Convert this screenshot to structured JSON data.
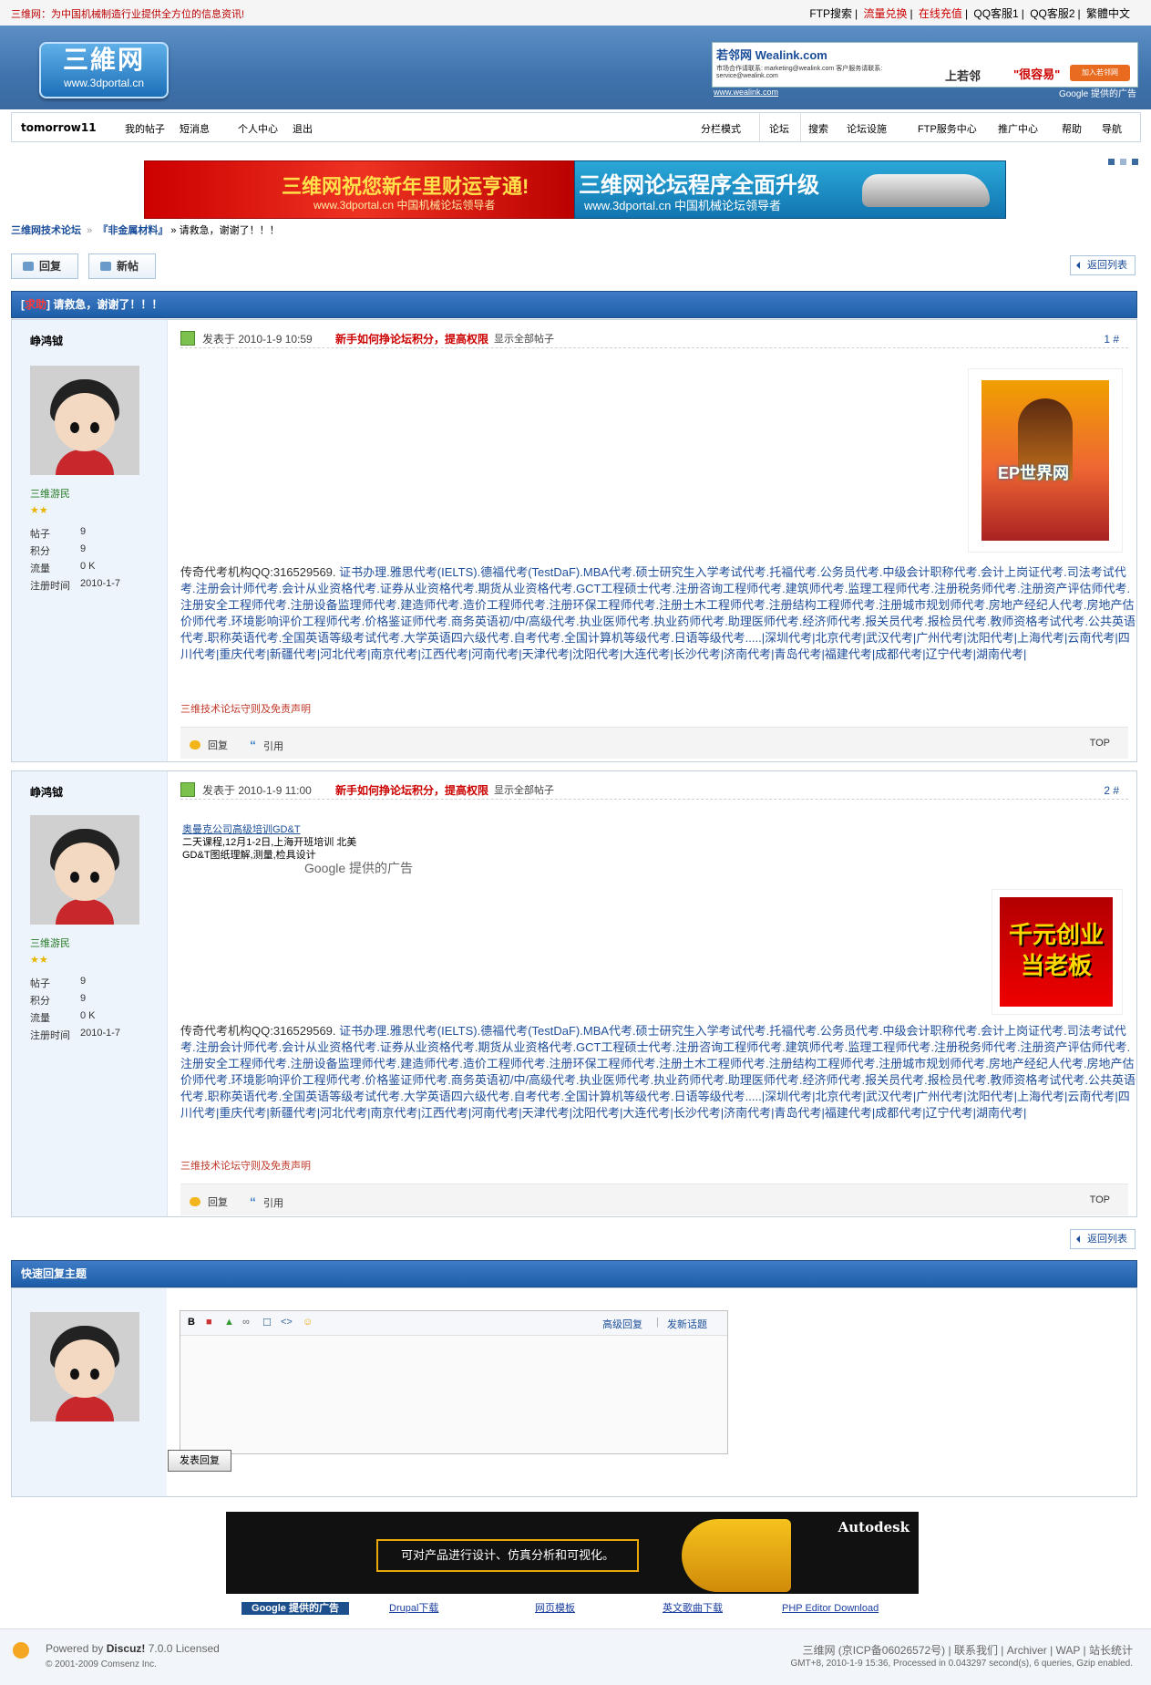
{
  "topbar": {
    "notice": "三维网：为中国机械制造行业提供全方位的信息资讯!",
    "links": [
      "FTP搜索",
      "流量兑换",
      "在线充值",
      "QQ客服1",
      "QQ客服2",
      "繁體中文"
    ]
  },
  "header": {
    "logo_text": "三維网",
    "logo_url": "www.3dportal.cn",
    "ad_brand": "若邻网 Wealink.com",
    "ad_contact": "市场合作请联系: marketing@wealink.com  客户服务请联系: service@wealink.com",
    "ad_slogan1": "上若邻",
    "ad_slogan2": "\"很容易\"",
    "ad_button": "加入若邻网",
    "ad_url": "www.wealink.com",
    "google_ad": "Google 提供的广告"
  },
  "nav": {
    "username": "tomorrow11",
    "left": [
      "我的帖子",
      "短消息",
      "个人中心",
      "退出"
    ],
    "right": [
      "分栏模式",
      "论坛",
      "搜索",
      "论坛设施",
      "FTP服务中心",
      "推广中心",
      "帮助",
      "导航"
    ],
    "current": "论坛"
  },
  "banners": {
    "b1_title": "三维网祝您新年里财运亨通!",
    "b1_sub": "www.3dportal.cn 中国机械论坛领导者",
    "b2_title": "三维网论坛程序全面升级",
    "b2_sub": "www.3dportal.cn 中国机械论坛领导者"
  },
  "breadcrumb": {
    "home": "三维网技术论坛",
    "board": "『非金属材料』",
    "current": "» 请救急，谢谢了！！！"
  },
  "buttons": {
    "reply": "回复",
    "newpost": "新帖",
    "back": "返回列表"
  },
  "thread": {
    "tag": "求助",
    "title": "请救急，谢谢了！！！"
  },
  "posts": [
    {
      "author": "峥鸿钺",
      "rank": "三维游民",
      "stars": "★★",
      "stats": [
        [
          "帖子",
          "9"
        ],
        [
          "积分",
          "9"
        ],
        [
          "流量",
          "0 K"
        ],
        [
          "注册时间",
          "2010-1-7"
        ]
      ],
      "date": "发表于 2010-1-9 10:59",
      "promo": "新手如何挣论坛积分，提高权限",
      "show_all": "显示全部帖子",
      "floor": "1 #",
      "image_text": "EP世界网",
      "lead": "传奇代考机构QQ:316529569.",
      "body": "证书办理.雅思代考(IELTS).德福代考(TestDaF).MBA代考.硕士研究生入学考试代考.托福代考.公务员代考.中级会计职称代考.会计上岗证代考.司法考试代考.注册会计师代考.会计从业资格代考.证券从业资格代考.期货从业资格代考.GCT工程硕士代考.注册咨询工程师代考.建筑师代考.监理工程师代考.注册税务师代考.注册资产评估师代考.注册安全工程师代考.注册设备监理师代考.建造师代考.造价工程师代考.注册环保工程师代考.注册土木工程师代考.注册结构工程师代考.注册城市规划师代考.房地产经纪人代考.房地产估价师代考.环境影响评价工程师代考.价格鉴证师代考.商务英语初/中/高级代考.执业医师代考.执业药师代考.助理医师代考.经济师代考.报关员代考.报检员代考.教师资格考试代考.公共英语代考.职称英语代考.全国英语等级考试代考.大学英语四六级代考.自考代考.全国计算机等级代考.日语等级代考.....|深圳代考|北京代考|武汉代考|广州代考|沈阳代考|上海代考|云南代考|四川代考|重庆代考|新疆代考|河北代考|南京代考|江西代考|河南代考|天津代考|沈阳代考|大连代考|长沙代考|济南代考|青岛代考|福建代考|成都代考|辽宁代考|湖南代考|",
      "rules": "三维技术论坛守则及免责声明",
      "reply": "回复",
      "quote": "引用",
      "top": "TOP"
    },
    {
      "author": "峥鸿钺",
      "rank": "三维游民",
      "stars": "★★",
      "stats": [
        [
          "帖子",
          "9"
        ],
        [
          "积分",
          "9"
        ],
        [
          "流量",
          "0 K"
        ],
        [
          "注册时间",
          "2010-1-7"
        ]
      ],
      "date": "发表于 2010-1-9 11:00",
      "promo": "新手如何挣论坛积分，提高权限",
      "show_all": "显示全部帖子",
      "floor": "2 #",
      "inline_ad_title": "奥曼克公司高级培训GD&T",
      "inline_ad_line1": "二天课程,12月1-2日,上海开班培训  北美",
      "inline_ad_line2": "GD&T图纸理解,测量,检具设计",
      "inline_ad_brand": "Google 提供的广告",
      "image_text": "千元创业当老板",
      "lead": "传奇代考机构QQ:316529569.",
      "body": "证书办理.雅思代考(IELTS).德福代考(TestDaF).MBA代考.硕士研究生入学考试代考.托福代考.公务员代考.中级会计职称代考.会计上岗证代考.司法考试代考.注册会计师代考.会计从业资格代考.证券从业资格代考.期货从业资格代考.GCT工程硕士代考.注册咨询工程师代考.建筑师代考.监理工程师代考.注册税务师代考.注册资产评估师代考.注册安全工程师代考.注册设备监理师代考.建造师代考.造价工程师代考.注册环保工程师代考.注册土木工程师代考.注册结构工程师代考.注册城市规划师代考.房地产经纪人代考.房地产估价师代考.环境影响评价工程师代考.价格鉴证师代考.商务英语初/中/高级代考.执业医师代考.执业药师代考.助理医师代考.经济师代考.报关员代考.报检员代考.教师资格考试代考.公共英语代考.职称英语代考.全国英语等级考试代考.大学英语四六级代考.自考代考.全国计算机等级代考.日语等级代考.....|深圳代考|北京代考|武汉代考|广州代考|沈阳代考|上海代考|云南代考|四川代考|重庆代考|新疆代考|河北代考|南京代考|江西代考|河南代考|天津代考|沈阳代考|大连代考|长沙代考|济南代考|青岛代考|福建代考|成都代考|辽宁代考|湖南代考|",
      "rules": "三维技术论坛守则及免责声明",
      "reply": "回复",
      "quote": "引用",
      "top": "TOP"
    }
  ],
  "quick_reply": {
    "title": "快速回复主题",
    "advanced": "高级回复",
    "new_topic": "发新话题",
    "submit": "发表回复",
    "toolbar": [
      "B",
      "■",
      "▲",
      "∞",
      "☐",
      "<>",
      "☺"
    ]
  },
  "autodesk": {
    "brand": "Autodesk",
    "slogan": "可对产品进行设计、仿真分析和可视化。"
  },
  "ad_links": {
    "google": "Google 提供的广告",
    "links": [
      "Drupal下载",
      "网页模板",
      "英文歌曲下载",
      "PHP Editor Download"
    ]
  },
  "footer": {
    "powered_prefix": "Powered by",
    "powered_brand": "Discuz!",
    "powered_suffix": "7.0.0 Licensed",
    "copyright": "© 2001-2009 Comsenz Inc.",
    "links": "三维网 (京ICP备06026572号) | 联系我们 | Archiver | WAP | 站长统计",
    "gmt": "GMT+8, 2010-1-9 15:36, Processed in 0.043297 second(s), 6 queries, Gzip enabled."
  }
}
